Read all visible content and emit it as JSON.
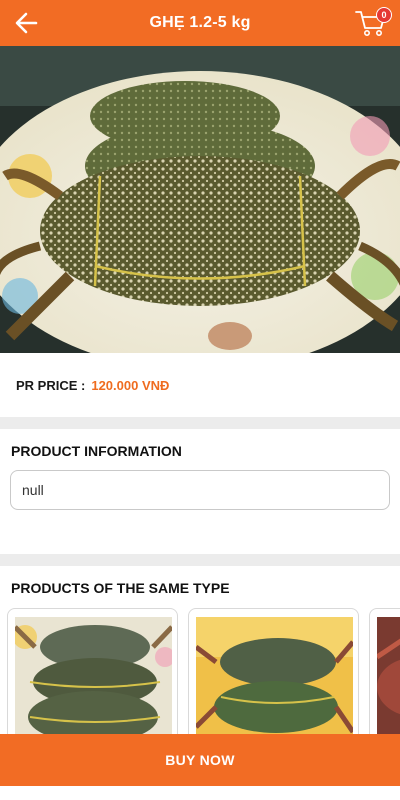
{
  "header": {
    "title": "GHẸ 1.2-5 kg",
    "back_icon": "arrow-left-icon",
    "cart_icon": "cart-icon",
    "cart_count": "0"
  },
  "product": {
    "image_alt": "crab-photo",
    "price_label": "PR PRICE :",
    "price_value": "120.000 VNĐ"
  },
  "info": {
    "heading": "PRODUCT INFORMATION",
    "value": "null"
  },
  "related": {
    "heading": "PRODUCTS OF THE SAME TYPE",
    "items": [
      {
        "image": "crab-thumbnail-1"
      },
      {
        "image": "crab-thumbnail-2"
      },
      {
        "image": "crab-thumbnail-3"
      }
    ]
  },
  "footer": {
    "buy_label": "BUY NOW"
  },
  "colors": {
    "brand": "#f26c24",
    "price": "#ef6c1f",
    "badge": "#e53935"
  }
}
